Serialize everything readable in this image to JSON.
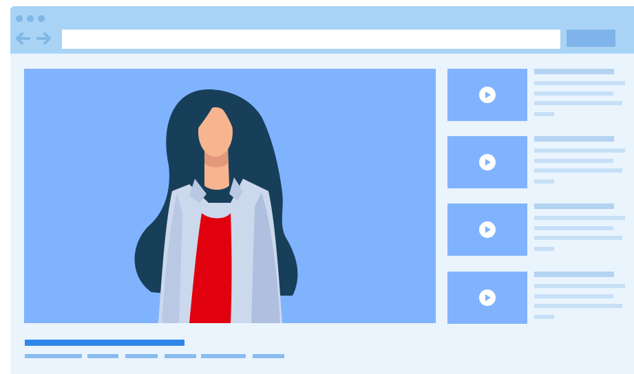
{
  "browser": {
    "window_dots": [
      "dot",
      "dot",
      "dot"
    ],
    "back_icon": "arrow-left-icon",
    "forward_icon": "arrow-right-icon",
    "url_value": "",
    "url_placeholder": "",
    "go_label": ""
  },
  "player": {
    "subject": "woman-illustration",
    "colors": {
      "background": "#80b3fd",
      "hair": "#183f5a",
      "skin": "#f6b58f",
      "top": "#e1000e",
      "cardigan": "#ccd8ec"
    }
  },
  "recommendations": {
    "items": [
      {
        "thumbnail_icon": "play-icon"
      },
      {
        "thumbnail_icon": "play-icon"
      },
      {
        "thumbnail_icon": "play-icon"
      },
      {
        "thumbnail_icon": "play-icon"
      }
    ]
  },
  "colors": {
    "titlebar": "#a8d3f5",
    "page_background": "#eaf4fd",
    "accent": "#2f86e8",
    "placeholder_line": "#c7dff7"
  }
}
